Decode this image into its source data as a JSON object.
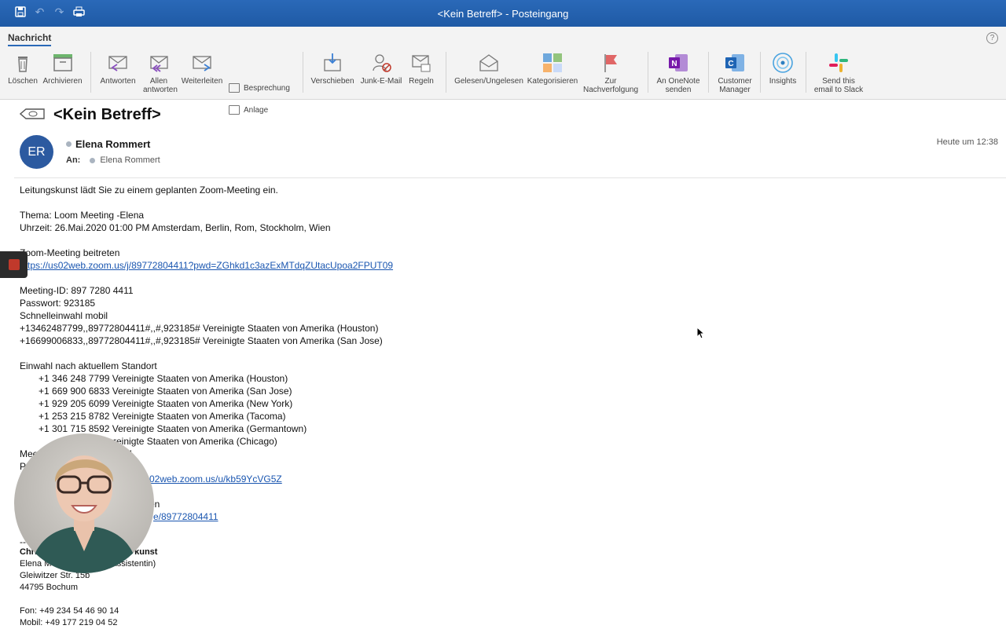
{
  "window": {
    "title": "<Kein Betreff> - Posteingang"
  },
  "ribbon": {
    "tab": "Nachricht",
    "help": "?",
    "buttons": {
      "delete": "Löschen",
      "archive": "Archivieren",
      "reply": "Antworten",
      "reply_all": "Allen antworten",
      "forward": "Weiterleiten",
      "meeting": "Besprechung",
      "attachment": "Anlage",
      "move": "Verschieben",
      "junk": "Junk-E-Mail",
      "rules": "Regeln",
      "read_unread": "Gelesen/Ungelesen",
      "categorize": "Kategorisieren",
      "followup": "Zur Nachverfolgung",
      "onenote": "An OneNote senden",
      "customer_manager": "Customer Manager",
      "insights": "Insights",
      "slack": "Send this email to Slack"
    }
  },
  "message": {
    "subject": "<Kein Betreff>",
    "avatar_initials": "ER",
    "sender": "Elena Rommert",
    "to_label": "An:",
    "to": "Elena Rommert",
    "time": "Heute um 12:38",
    "body": {
      "l1": "Leitungskunst lädt Sie zu einem geplanten Zoom-Meeting ein.",
      "l2": "Thema: Loom Meeting -Elena",
      "l3": "Uhrzeit: 26.Mai.2020 01:00 PM Amsterdam, Berlin, Rom, Stockholm, Wien",
      "l4": "Zoom-Meeting beitreten",
      "link1": "https://us02web.zoom.us/j/89772804411?pwd=ZGhkd1c3azExMTdqZUtacUpoa2FPUT09",
      "l5": "Meeting-ID: 897 7280 4411",
      "l6": "Passwort: 923185",
      "l7": "Schnelleinwahl mobil",
      "l8": "+13462487799,,89772804411#,,#,923185# Vereinigte Staaten von Amerika (Houston)",
      "l9": "+16699006833,,89772804411#,,#,923185# Vereinigte Staaten von Amerika (San Jose)",
      "l10": "Einwahl nach aktuellem Standort",
      "d1": "+1 346 248 7799 Vereinigte Staaten von Amerika (Houston)",
      "d2": "+1 669 900 6833 Vereinigte Staaten von Amerika (San Jose)",
      "d3": "+1 929 205 6099 Vereinigte Staaten von Amerika (New York)",
      "d4": "+1 253 215 8782 Vereinigte Staaten von Amerika (Tacoma)",
      "d5": "+1 301 715 8592 Vereinigte Staaten von Amerika (Germantown)",
      "d6": "Vereinigte Staaten von Amerika (Chicago)",
      "p1": "Meeting-ID: 897 7280 4411",
      "p2": "P",
      "link2": "02web.zoom.us/u/kb59YcVG5Z",
      "p3": "en",
      "link3": "e/89772804411",
      "p4": "--"
    },
    "signature": {
      "s1a": "Chris",
      "s1b": "kunst",
      "s2a": "Elena M",
      "s2b": "Assistentin)",
      "s3": "Gleiwitzer Str. 15b",
      "s4": "44795 Bochum",
      "s5": "Fon: +49 234 54 46 90 14",
      "s6": "Mobil: +49 177 219 04 52"
    }
  }
}
